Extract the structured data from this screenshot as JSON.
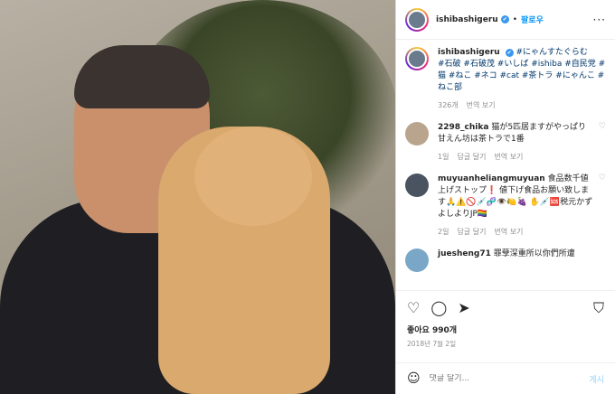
{
  "header": {
    "username": "ishibashigeru",
    "verified": "✔",
    "follow": "팔로우",
    "more": "···"
  },
  "caption": {
    "username": "ishibashigeru",
    "verified": "✔",
    "text": "#にゃんすたぐらむ",
    "tags": "#石破 #石破茂 #いしば #ishiba #自民党 #猫 #ねこ #ネコ #cat #茶トラ #にゃんこ #ねこ部",
    "likes": "326개",
    "reply": "번역 보기"
  },
  "comments": [
    {
      "username": "2298_chika",
      "text": "猫が5匹居ますがやっぱり甘えん坊は茶トラで1番",
      "time": "1일",
      "reply": "답글 달기",
      "translate": "번역 보기"
    },
    {
      "username": "muyuanheliangmuyuan",
      "text": "食品数千値上げストップ❗ 値下げ食品お願い致します🙏⚠️🚫💉🧬👁️🍋🍇 ✋💉🆘税元かずよしよりJP🏳️‍🌈",
      "time": "2일",
      "reply": "답글 달기",
      "translate": "번역 보기"
    },
    {
      "username": "juesheng71",
      "text": "罪孽深重所以你們所遭"
    }
  ],
  "actions": {
    "like": "♡",
    "comment": "◯",
    "share": "➤",
    "save": "⛉"
  },
  "likes": "좋아요 990개",
  "date": "2018년 7월 2일",
  "add_comment": {
    "emoji": "☺",
    "placeholder": "댓글 달기...",
    "post": "게시"
  }
}
